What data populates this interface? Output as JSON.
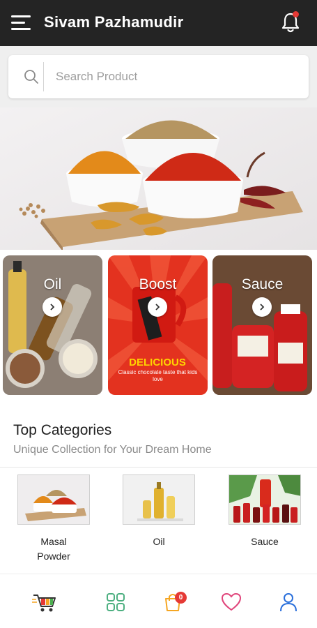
{
  "header": {
    "title": "Sivam Pazhamudir",
    "menu_icon": "menu-icon",
    "notification_icon": "bell-icon",
    "notification_dot_color": "#e53935",
    "background": "#242424"
  },
  "search": {
    "placeholder": "Search Product",
    "value": "",
    "icon": "search-icon"
  },
  "banner": {
    "description_icon": "spices-banner-image"
  },
  "category_cards": [
    {
      "label": "Oil",
      "icon": "chevron-right-icon"
    },
    {
      "label": "Boost",
      "icon": "chevron-right-icon",
      "tagline": "DELICIOUS",
      "subtext": "Classic chocolate taste that kids love"
    },
    {
      "label": "Sauce",
      "icon": "chevron-right-icon"
    }
  ],
  "top_categories": {
    "title": "Top Categories",
    "subtitle": "Unique Collection for Your Dream Home",
    "items": [
      {
        "name": "Masal Powder"
      },
      {
        "name": "Oil"
      },
      {
        "name": "Sauce"
      }
    ]
  },
  "bottom_nav": {
    "items": [
      {
        "name": "shop",
        "icon": "shopping-cart-icon"
      },
      {
        "name": "categories",
        "icon": "grid-icon"
      },
      {
        "name": "cart",
        "icon": "shopping-bag-icon",
        "badge": "0"
      },
      {
        "name": "wishlist",
        "icon": "heart-icon"
      },
      {
        "name": "profile",
        "icon": "user-icon"
      }
    ],
    "accent_colors": {
      "grid": "#4caf80",
      "bag": "#f5a623",
      "heart": "#e0457b",
      "user": "#2a6fdb",
      "badge": "#e53935"
    }
  }
}
